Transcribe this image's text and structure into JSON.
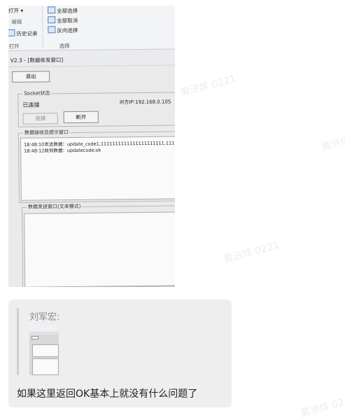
{
  "watermark": "黄浒烨 0221",
  "screen_photo": {
    "ribbon": {
      "open_label": "打开 ▾",
      "edit_label": "编辑",
      "history_label": "历史记录",
      "open_group_label": "打开",
      "select_all": "全部选择",
      "select_none": "全部取消",
      "invert_selection": "反向选择",
      "select_group_label": "选择"
    },
    "window_title": "V2.3 - [数据收发窗口]",
    "exit_button": "退出",
    "socket_group": {
      "title": "Socket状态",
      "status": "已连接",
      "peer_ip": "对方IP:192.168.0.105",
      "connect_button": "连接",
      "disconnect_button": "断开"
    },
    "receive_group": {
      "title": "数据接收及提示窗口",
      "log": [
        "18:48:10发送数据：update_code1,1111111111111111111111,111",
        "18:48:12收到数据：updatecode;ok"
      ]
    },
    "send_group": {
      "title": "数据发送窗口(文本模式)"
    }
  },
  "chat": {
    "quote_sender": "刘军宏:",
    "message": "如果这里返回OK基本上就没有什么问题了"
  }
}
